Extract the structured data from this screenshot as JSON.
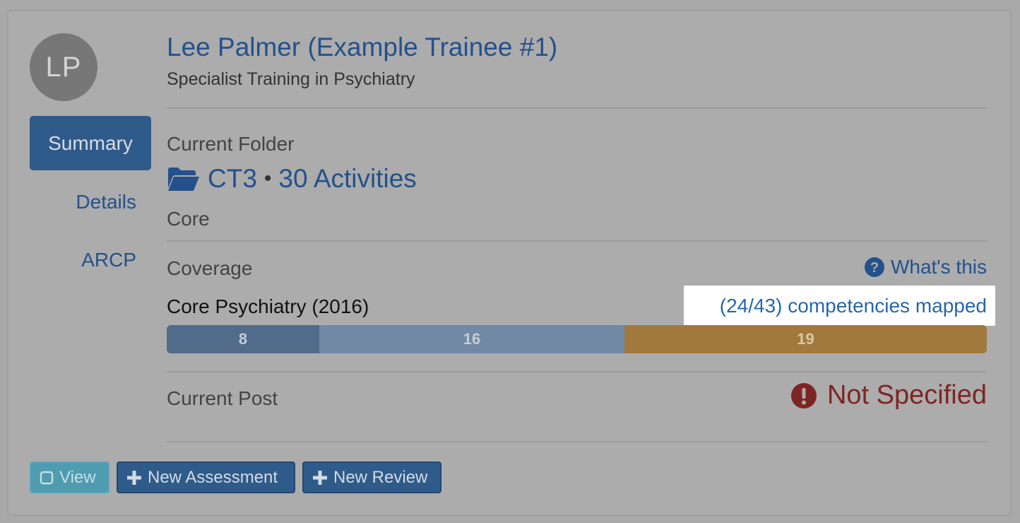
{
  "trainee": {
    "initials": "LP",
    "name": "Lee Palmer (Example Trainee #1)",
    "programme": "Specialist Training in Psychiatry"
  },
  "nav": {
    "summary": "Summary",
    "details": "Details",
    "arcp": "ARCP"
  },
  "folder": {
    "label": "Current Folder",
    "name": "CT3",
    "separator": "•",
    "activities": "30 Activities",
    "type": "Core",
    "icon": "folder-open-icon"
  },
  "coverage": {
    "label": "Coverage",
    "whats_this": "What's this",
    "curriculum": "Core Psychiatry (2016)",
    "mapped_text": "(24/43) competencies mapped",
    "segments": [
      {
        "label": "8",
        "value": 8,
        "color": "#526b8a"
      },
      {
        "label": "16",
        "value": 16,
        "color": "#7289a5"
      },
      {
        "label": "19",
        "value": 19,
        "color": "#a2793c"
      }
    ]
  },
  "post": {
    "label": "Current Post",
    "value": "Not Specified",
    "color": "#7e2524"
  },
  "actions": {
    "view": "View",
    "new_assessment": "New Assessment",
    "new_review": "New Review"
  },
  "colors": {
    "accent": "#2f5b8a",
    "link": "#24518b",
    "view_button": "#4f9bb0"
  }
}
